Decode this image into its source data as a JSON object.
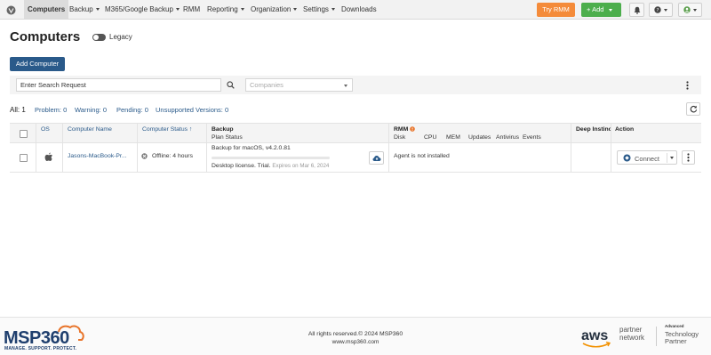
{
  "nav": {
    "items": [
      {
        "label": "Computers",
        "dropdown": false,
        "active": true
      },
      {
        "label": "Backup",
        "dropdown": true
      },
      {
        "label": "M365/Google Backup",
        "dropdown": true
      },
      {
        "label": "RMM",
        "dropdown": false
      },
      {
        "label": "Reporting",
        "dropdown": true
      },
      {
        "label": "Organization",
        "dropdown": true
      },
      {
        "label": "Settings",
        "dropdown": true
      },
      {
        "label": "Downloads",
        "dropdown": false
      }
    ],
    "try_rmm_label": "Try RMM",
    "add_label": "Add",
    "colors": {
      "try_rmm": "#f48b3a",
      "add": "#4cae4c",
      "primary": "#2a5a8a"
    }
  },
  "page": {
    "title": "Computers",
    "legacy_label": "Legacy",
    "add_computer_label": "Add Computer"
  },
  "search": {
    "placeholder": "Enter Search Request",
    "companies_placeholder": "Companies"
  },
  "filters": {
    "all": "All: 1",
    "problem": "Problem: 0",
    "warning": "Warning: 0",
    "pending": "Pending: 0",
    "unsupported": "Unsupported Versions: 0"
  },
  "table": {
    "headers": {
      "os": "OS",
      "computer_name": "Computer Name",
      "computer_status": "Computer Status ↑",
      "backup": "Backup",
      "plan_status": "Plan Status",
      "rmm": "RMM",
      "disk": "Disk",
      "cpu": "CPU",
      "mem": "MEM",
      "updates": "Updates",
      "antivirus": "Antivirus",
      "events": "Events",
      "deep_instinct": "Deep Instinct",
      "action": "Action"
    },
    "rows": [
      {
        "os_icon": "apple-icon",
        "computer_name": "Jasons-MacBook-Pr...",
        "status": "Offline: 4 hours",
        "backup_version": "Backup for macOS, v4.2.0.81",
        "backup_progress": 0,
        "license": "Desktop license. Trial.",
        "expires": "Expires on Mar 6, 2024",
        "rmm_status": "Agent is not installed",
        "action_label": "Connect"
      }
    ]
  },
  "footer": {
    "logo_text": "MSP360",
    "tagline": "MANAGE. SUPPORT. PROTECT.",
    "copyright": "All rights reserved.© 2024 MSP360",
    "website": "www.msp360.com",
    "aws_text": "aws",
    "partner": "partner",
    "network": "network",
    "advanced": "Advanced",
    "technology": "Technology",
    "partner2": "Partner"
  }
}
